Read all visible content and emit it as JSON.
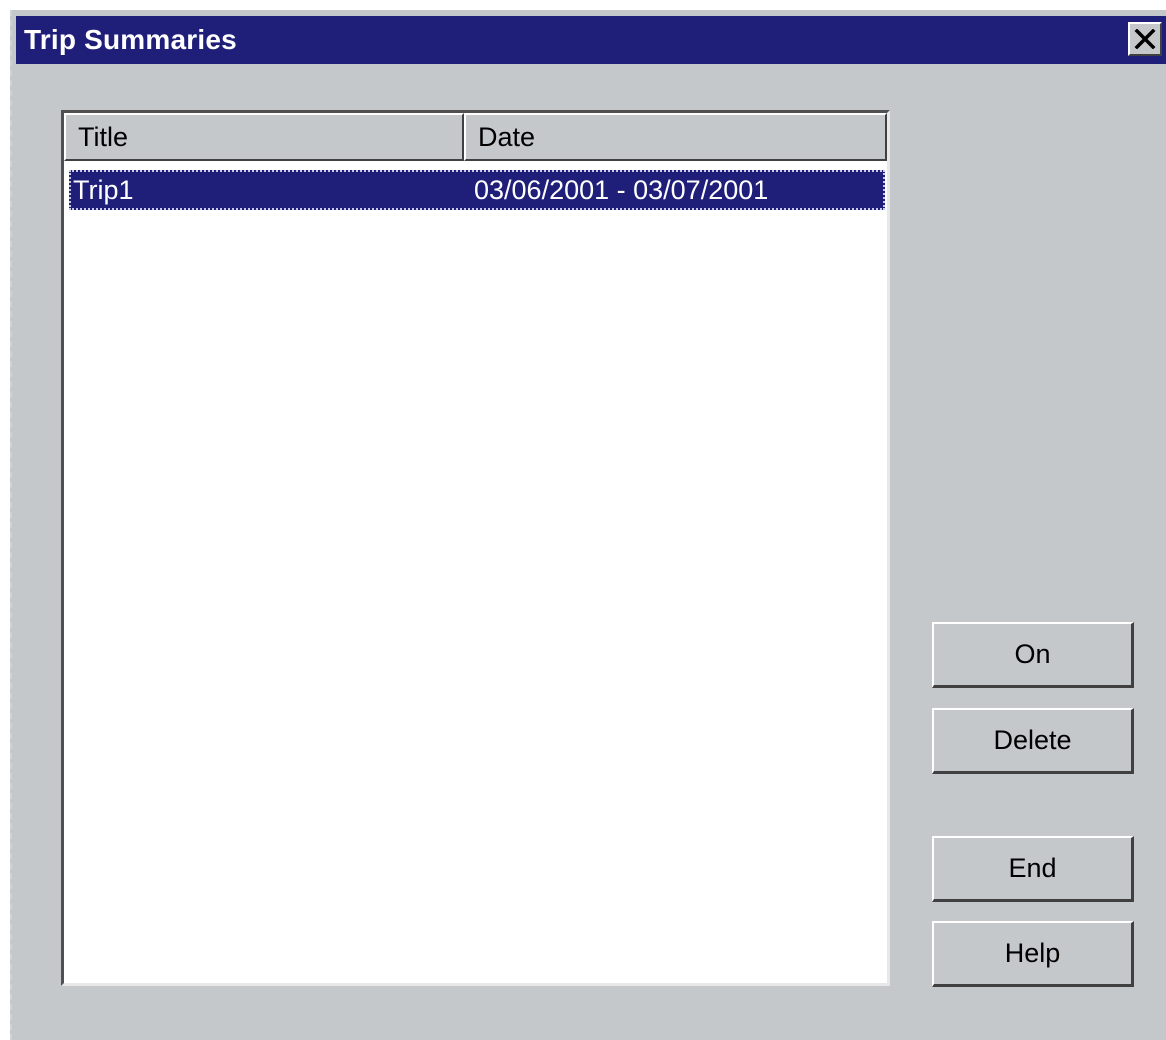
{
  "window": {
    "title": "Trip Summaries",
    "close_icon": "close-icon",
    "colors": {
      "titlebar": "#1f1f7a",
      "face": "#c5c8cb",
      "selection": "#1f1f7a"
    }
  },
  "list": {
    "columns": [
      "Title",
      "Date"
    ],
    "rows": [
      {
        "title": "Trip1",
        "date": "03/06/2001 - 03/07/2001",
        "selected": true
      }
    ]
  },
  "buttons": {
    "on": "On",
    "delete": "Delete",
    "end": "End",
    "help": "Help"
  }
}
